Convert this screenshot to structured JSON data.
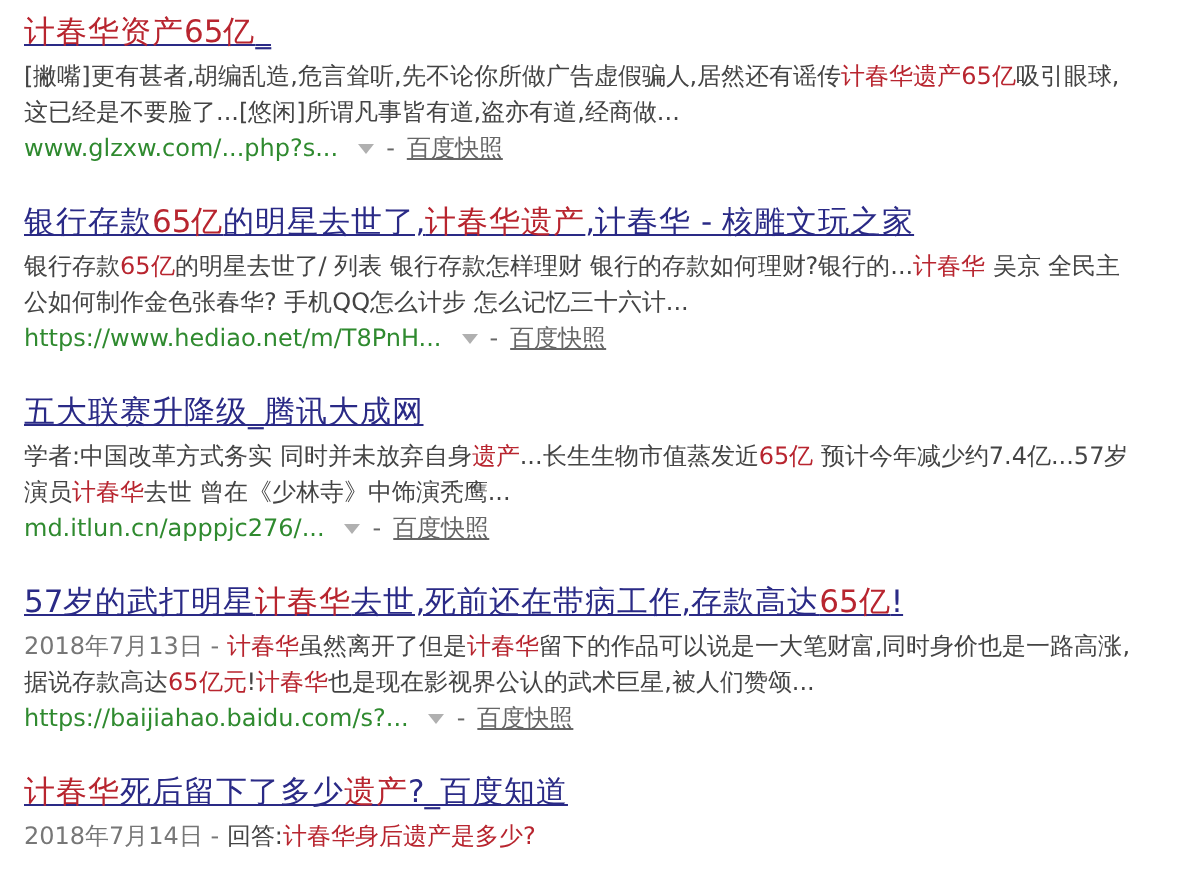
{
  "results": [
    {
      "title": [
        {
          "text": "计春华资产65亿",
          "highlight": true
        },
        {
          "text": "_",
          "highlight": false
        }
      ],
      "snippet": [
        {
          "text": "[撇嘴]更有甚者,胡编乱造,危言耸听,先不论你所做广告虚假骗人,居然还有谣传",
          "highlight": false
        },
        {
          "text": "计春华遗产65亿",
          "highlight": true
        },
        {
          "text": "吸引眼球,这已经是不要脸了...[悠闲]所谓凡事皆有道,盗亦有道,经商做...",
          "highlight": false
        }
      ],
      "url": "www.glzxw.com/...php?s...",
      "separator": "-",
      "cache_link": "百度快照"
    },
    {
      "title": [
        {
          "text": "银行存款",
          "highlight": false
        },
        {
          "text": "65亿",
          "highlight": true
        },
        {
          "text": "的明星去世了,",
          "highlight": false
        },
        {
          "text": "计春华遗产",
          "highlight": true
        },
        {
          "text": ",计春华 - 核雕文玩之家",
          "highlight": false
        }
      ],
      "snippet": [
        {
          "text": "银行存款",
          "highlight": false
        },
        {
          "text": "65亿",
          "highlight": true
        },
        {
          "text": "的明星去世了/ 列表 银行存款怎样理财 银行的存款如何理财?银行的...",
          "highlight": false
        },
        {
          "text": "计春华",
          "highlight": true
        },
        {
          "text": " 吴京 全民主公如何制作金色张春华? 手机QQ怎么计步 怎么记忆三十六计...",
          "highlight": false
        }
      ],
      "url": "https://www.hediao.net/m/T8PnH...",
      "separator": "-",
      "cache_link": "百度快照"
    },
    {
      "title": [
        {
          "text": "五大联赛升降级_腾讯大成网",
          "highlight": false
        }
      ],
      "snippet": [
        {
          "text": "学者:中国改革方式务实 同时并未放弃自身",
          "highlight": false
        },
        {
          "text": "遗产",
          "highlight": true
        },
        {
          "text": "...长生生物市值蒸发近",
          "highlight": false
        },
        {
          "text": "65亿",
          "highlight": true
        },
        {
          "text": " 预计今年减少约7.4亿...57岁演员",
          "highlight": false
        },
        {
          "text": "计春华",
          "highlight": true
        },
        {
          "text": "去世 曾在《少林寺》中饰演秃鹰...",
          "highlight": false
        }
      ],
      "url": "md.itlun.cn/apppjc276/...",
      "separator": "-",
      "cache_link": "百度快照"
    },
    {
      "title": [
        {
          "text": "57岁的武打明星",
          "highlight": false
        },
        {
          "text": "计春华",
          "highlight": true
        },
        {
          "text": "去世,死前还在带病工作,存款高达",
          "highlight": false
        },
        {
          "text": "65亿",
          "highlight": true
        },
        {
          "text": "!",
          "highlight": false
        }
      ],
      "date": "2018年7月13日 - ",
      "snippet": [
        {
          "text": "计春华",
          "highlight": true
        },
        {
          "text": "虽然离开了但是",
          "highlight": false
        },
        {
          "text": "计春华",
          "highlight": true
        },
        {
          "text": "留下的作品可以说是一大笔财富,同时身价也是一路高涨,据说存款高达",
          "highlight": false
        },
        {
          "text": "65亿元",
          "highlight": true
        },
        {
          "text": "!",
          "highlight": false
        },
        {
          "text": "计春华",
          "highlight": true
        },
        {
          "text": "也是现在影视界公认的武术巨星,被人们赞颂...",
          "highlight": false
        }
      ],
      "url": "https://baijiahao.baidu.com/s?...",
      "separator": "-",
      "cache_link": "百度快照"
    },
    {
      "title": [
        {
          "text": "计春华",
          "highlight": true
        },
        {
          "text": "死后留下了多少",
          "highlight": false
        },
        {
          "text": "遗产",
          "highlight": true
        },
        {
          "text": "?_百度知道",
          "highlight": false
        }
      ],
      "date": "2018年7月14日 - ",
      "snippet": [
        {
          "text": "回答:",
          "highlight": false
        },
        {
          "text": "计春华身后遗产是多少?",
          "highlight": true
        }
      ]
    }
  ]
}
